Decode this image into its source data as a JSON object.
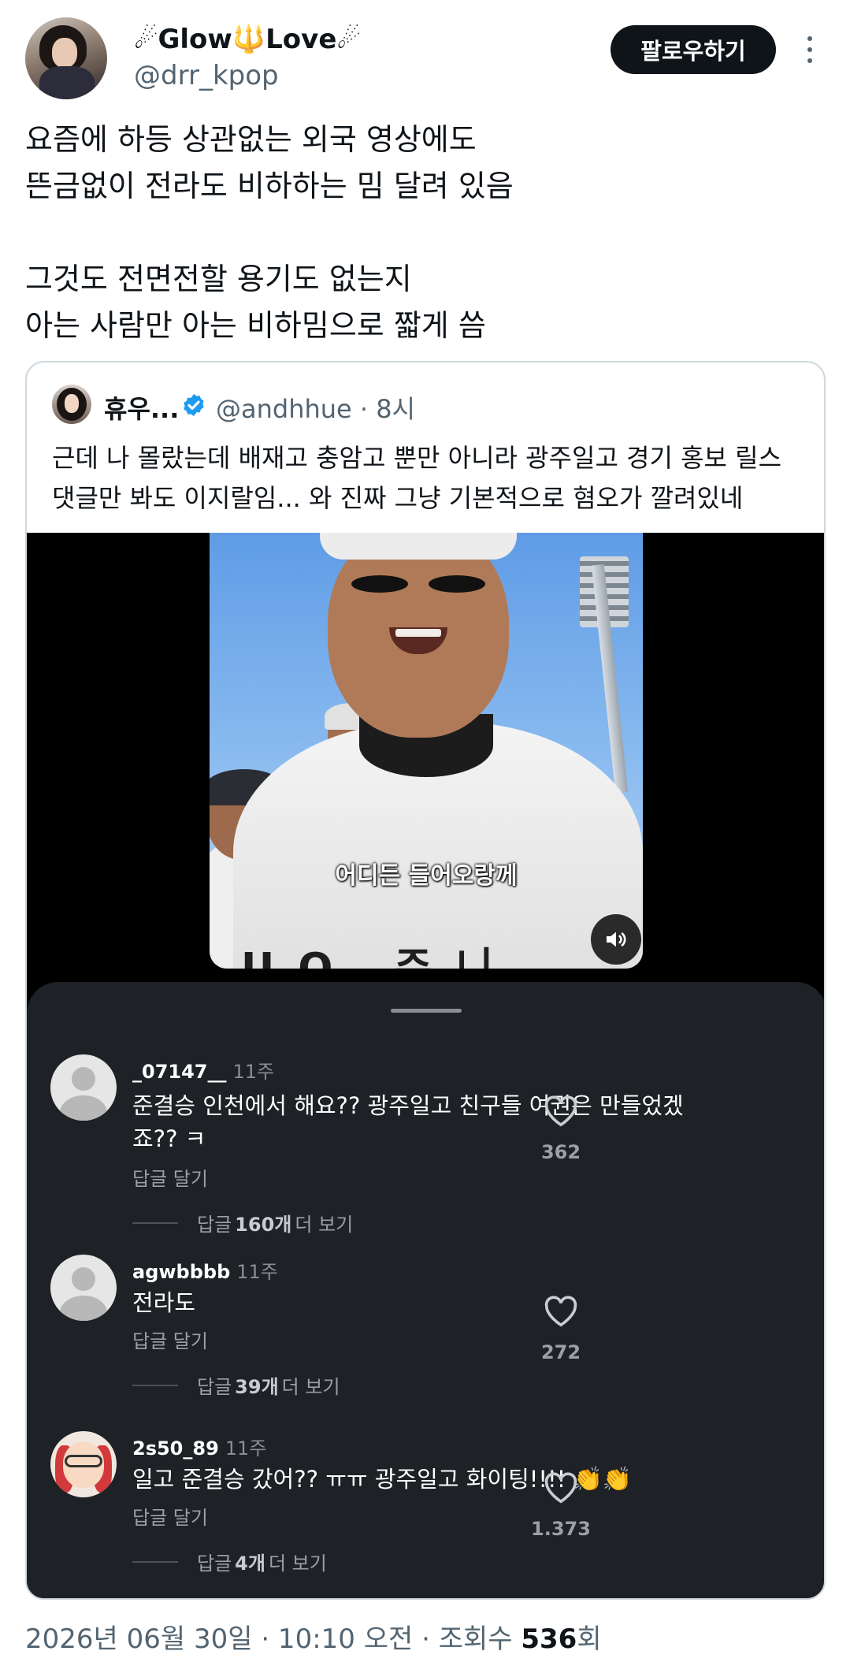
{
  "author": {
    "display_name": "☄Glow🔱Love☄",
    "handle": "@drr_kpop",
    "follow_label": "팔로우하기"
  },
  "tweet": {
    "lines": [
      "요즘에 하등 상관없는 외국 영상에도",
      "뜬금없이 전라도 비하하는 밈 달려 있음",
      "",
      "그것도 전면전할 용기도 없는지",
      "아는 사람만 아는 비하밈으로 짧게 씀"
    ]
  },
  "quote": {
    "name": "휴우...",
    "handle_time": "@andhhue · 8시",
    "lines": [
      "근데 나 몰랐는데 배재고 충암고 뿐만 아니라 광주일고 경기 홍보 릴스",
      "댓글만 봐도 이지랄임... 와 진짜 그냥 기본적으로 혐오가 깔려있네"
    ],
    "video": {
      "subtitle": "어디든 들어오랑께",
      "jersey": "UO 주니"
    },
    "comments": [
      {
        "user": "_07147__",
        "time": "11주",
        "lines": [
          "준결승 인천에서 해요?? 광주일고 친구들 여권은 만들었겠",
          "죠?? ㅋ"
        ],
        "reply_label": "답글 달기",
        "more_prefix": "답글",
        "more_count": "160개",
        "more_suffix": "더 보기",
        "likes": "362"
      },
      {
        "user": "agwbbbb",
        "time": "11주",
        "lines": [
          "전라도"
        ],
        "reply_label": "답글 달기",
        "more_prefix": "답글",
        "more_count": "39개",
        "more_suffix": "더 보기",
        "likes": "272"
      },
      {
        "user": "2s50_89",
        "time": "11주",
        "lines": [
          "일고 준결승 갔어?? ㅠㅠ 광주일고 화이팅!!!! "
        ],
        "clap": "👏👏",
        "reply_label": "답글 달기",
        "more_prefix": "답글",
        "more_count": "4개",
        "more_suffix": "더 보기",
        "likes": "1.373"
      }
    ]
  },
  "footer": {
    "meta": "2026년 06월 30일 · 10:10 오전 · 조회수 ",
    "views": "536",
    "views_suffix": "회"
  },
  "colors": {
    "text": "#0f1419",
    "secondary": "#536471",
    "verified": "#1d9bf0",
    "sheet": "#1e2125"
  },
  "icons": [
    "more-icon",
    "verified-icon",
    "volume-icon",
    "heart-icon",
    "user-placeholder-icon"
  ]
}
